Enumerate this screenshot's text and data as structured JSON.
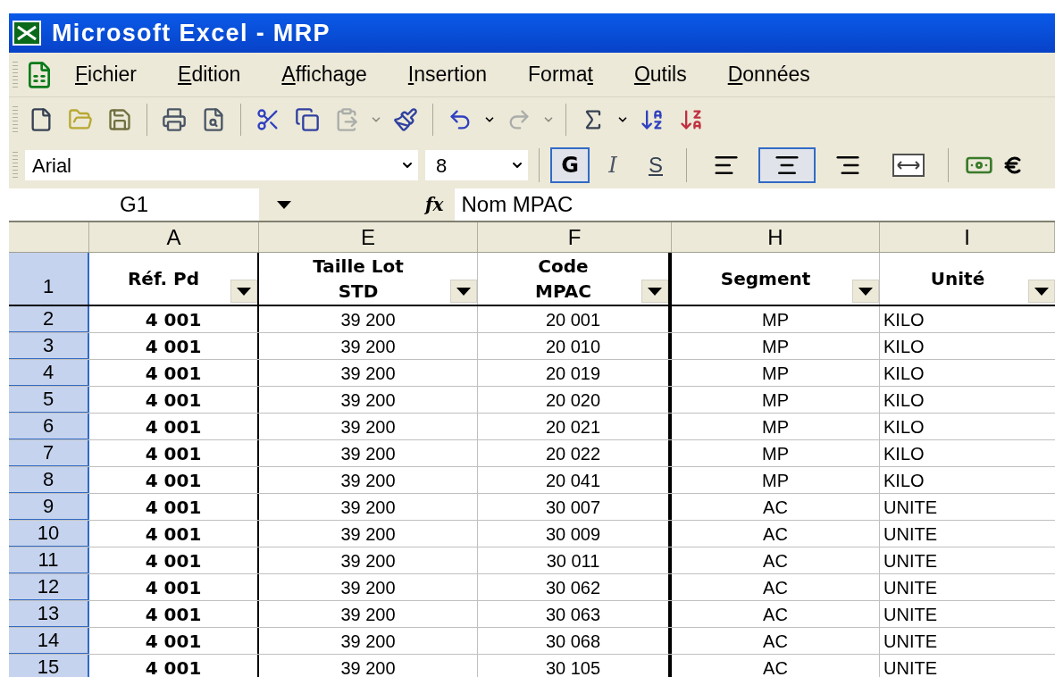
{
  "window": {
    "title": "Microsoft Excel - MRP"
  },
  "menu": [
    {
      "key": "F",
      "after": "ichier"
    },
    {
      "key": "E",
      "after": "dition"
    },
    {
      "key": "A",
      "after": "ffichage"
    },
    {
      "key": "I",
      "after": "nsertion"
    },
    {
      "before": "Forma",
      "key": "t"
    },
    {
      "key": "O",
      "after": "utils"
    },
    {
      "key": "D",
      "after": "onnées"
    }
  ],
  "toolbar": [
    {
      "kind": "new"
    },
    {
      "kind": "open"
    },
    {
      "kind": "save"
    },
    {
      "kind": "sep"
    },
    {
      "kind": "print"
    },
    {
      "kind": "preview"
    },
    {
      "kind": "sep"
    },
    {
      "kind": "cut"
    },
    {
      "kind": "copy"
    },
    {
      "kind": "paste",
      "disabled": true
    },
    {
      "kind": "caret",
      "disabled": true
    },
    {
      "kind": "brush"
    },
    {
      "kind": "sep"
    },
    {
      "kind": "undo"
    },
    {
      "kind": "caret",
      "disabled": false
    },
    {
      "kind": "redo",
      "disabled": true
    },
    {
      "kind": "caret",
      "disabled": true
    },
    {
      "kind": "sep"
    },
    {
      "kind": "sum"
    },
    {
      "kind": "caret",
      "disabled": false
    },
    {
      "kind": "sortaz"
    },
    {
      "kind": "sortza"
    }
  ],
  "format_bar": {
    "font": "Arial",
    "size": "8",
    "styles": [
      {
        "label": "G",
        "kind": "bold",
        "selected": true
      },
      {
        "label": "I",
        "kind": "italic",
        "selected": false
      },
      {
        "label": "S",
        "kind": "underline",
        "selected": false
      }
    ],
    "align": [
      {
        "kind": "left",
        "selected": false
      },
      {
        "kind": "center",
        "selected": true
      },
      {
        "kind": "right",
        "selected": false
      },
      {
        "kind": "merge",
        "selected": false
      }
    ]
  },
  "formula_bar": {
    "cell": "G1",
    "fx": "fx",
    "value": "Nom MPAC"
  },
  "table": {
    "columns": [
      {
        "letter": "A",
        "header": [
          "Réf. Pd"
        ],
        "kind": "key"
      },
      {
        "letter": "E",
        "header": [
          "Taille Lot",
          "STD"
        ],
        "kind": "number"
      },
      {
        "letter": "F",
        "header": [
          "Code",
          "MPAC"
        ],
        "kind": "number"
      },
      {
        "letter": "H",
        "header": [
          "Segment"
        ],
        "kind": "number"
      },
      {
        "letter": "I",
        "header": [
          "Unité"
        ],
        "kind": "text"
      }
    ],
    "header_row": "1",
    "rows": [
      {
        "n": "2",
        "cells": [
          "4 001",
          "39 200",
          "20 001",
          "MP",
          "KILO"
        ]
      },
      {
        "n": "3",
        "cells": [
          "4 001",
          "39 200",
          "20 010",
          "MP",
          "KILO"
        ]
      },
      {
        "n": "4",
        "cells": [
          "4 001",
          "39 200",
          "20 019",
          "MP",
          "KILO"
        ]
      },
      {
        "n": "5",
        "cells": [
          "4 001",
          "39 200",
          "20 020",
          "MP",
          "KILO"
        ]
      },
      {
        "n": "6",
        "cells": [
          "4 001",
          "39 200",
          "20 021",
          "MP",
          "KILO"
        ]
      },
      {
        "n": "7",
        "cells": [
          "4 001",
          "39 200",
          "20 022",
          "MP",
          "KILO"
        ]
      },
      {
        "n": "8",
        "cells": [
          "4 001",
          "39 200",
          "20 041",
          "MP",
          "KILO"
        ]
      },
      {
        "n": "9",
        "cells": [
          "4 001",
          "39 200",
          "30 007",
          "AC",
          "UNITE"
        ]
      },
      {
        "n": "10",
        "cells": [
          "4 001",
          "39 200",
          "30 009",
          "AC",
          "UNITE"
        ]
      },
      {
        "n": "11",
        "cells": [
          "4 001",
          "39 200",
          "30 011",
          "AC",
          "UNITE"
        ]
      },
      {
        "n": "12",
        "cells": [
          "4 001",
          "39 200",
          "30 062",
          "AC",
          "UNITE"
        ]
      },
      {
        "n": "13",
        "cells": [
          "4 001",
          "39 200",
          "30 063",
          "AC",
          "UNITE"
        ]
      },
      {
        "n": "14",
        "cells": [
          "4 001",
          "39 200",
          "30 068",
          "AC",
          "UNITE"
        ]
      },
      {
        "n": "15",
        "cells": [
          "4 001",
          "39 200",
          "30 105",
          "AC",
          "UNITE"
        ]
      }
    ]
  }
}
